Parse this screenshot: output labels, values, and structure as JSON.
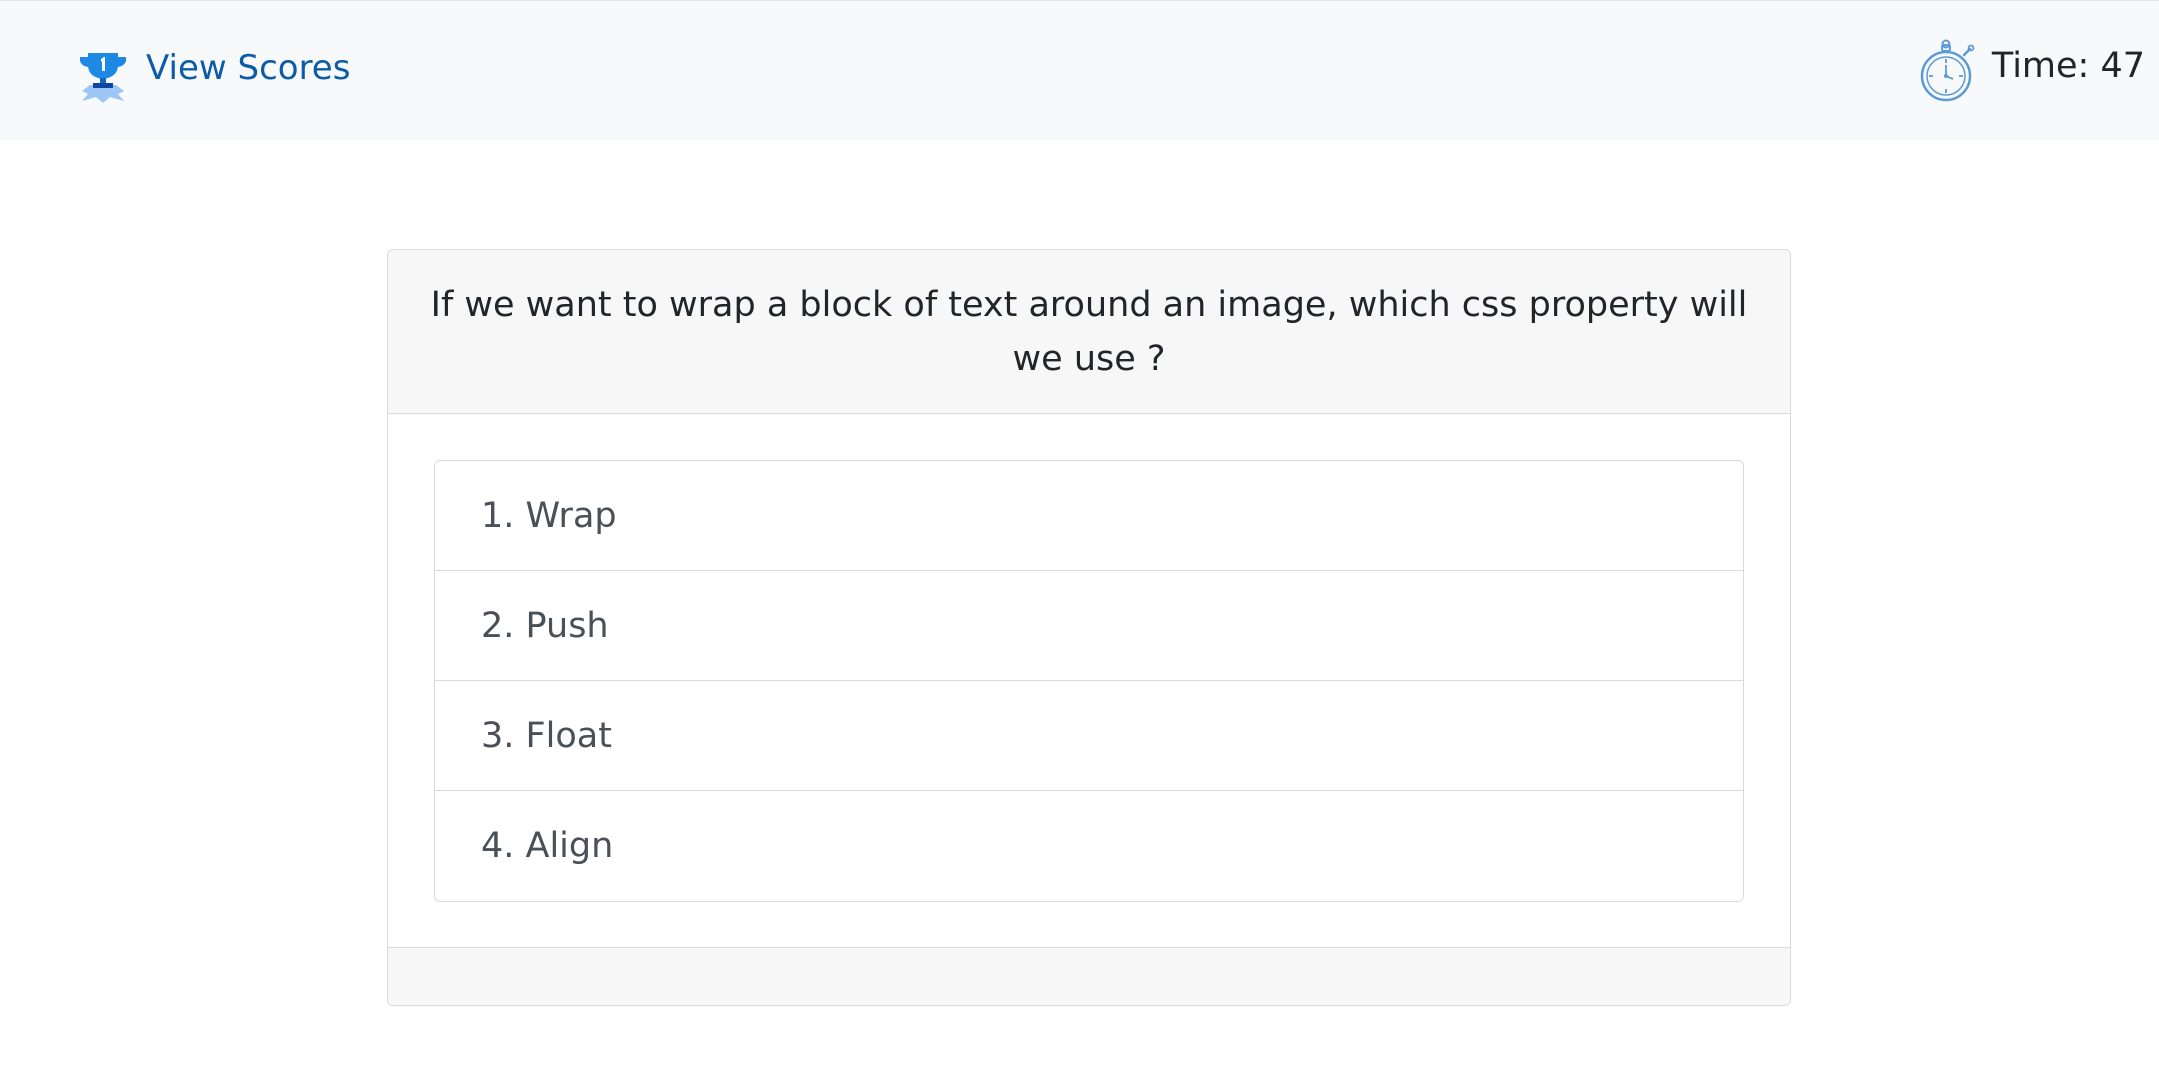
{
  "navbar": {
    "view_scores_label": "View Scores",
    "trophy_icon": "trophy-icon",
    "stopwatch_icon": "stopwatch-icon",
    "timer_label": "Time:",
    "timer_value": "47",
    "timer_text": "Time: 47"
  },
  "quiz": {
    "question": "If we want to wrap a block of text around an image, which css property will we use ?",
    "answers": [
      {
        "label": "1. Wrap"
      },
      {
        "label": "2. Push"
      },
      {
        "label": "3. Float"
      },
      {
        "label": "4. Align"
      }
    ]
  },
  "colors": {
    "link": "#0d5ca8",
    "navbar_bg": "#f8f9fa",
    "card_header_bg": "#f7f7f7",
    "border": "#d9dadb",
    "trophy_blue": "#1e88e5",
    "stopwatch_blue": "#5b9bd5"
  }
}
